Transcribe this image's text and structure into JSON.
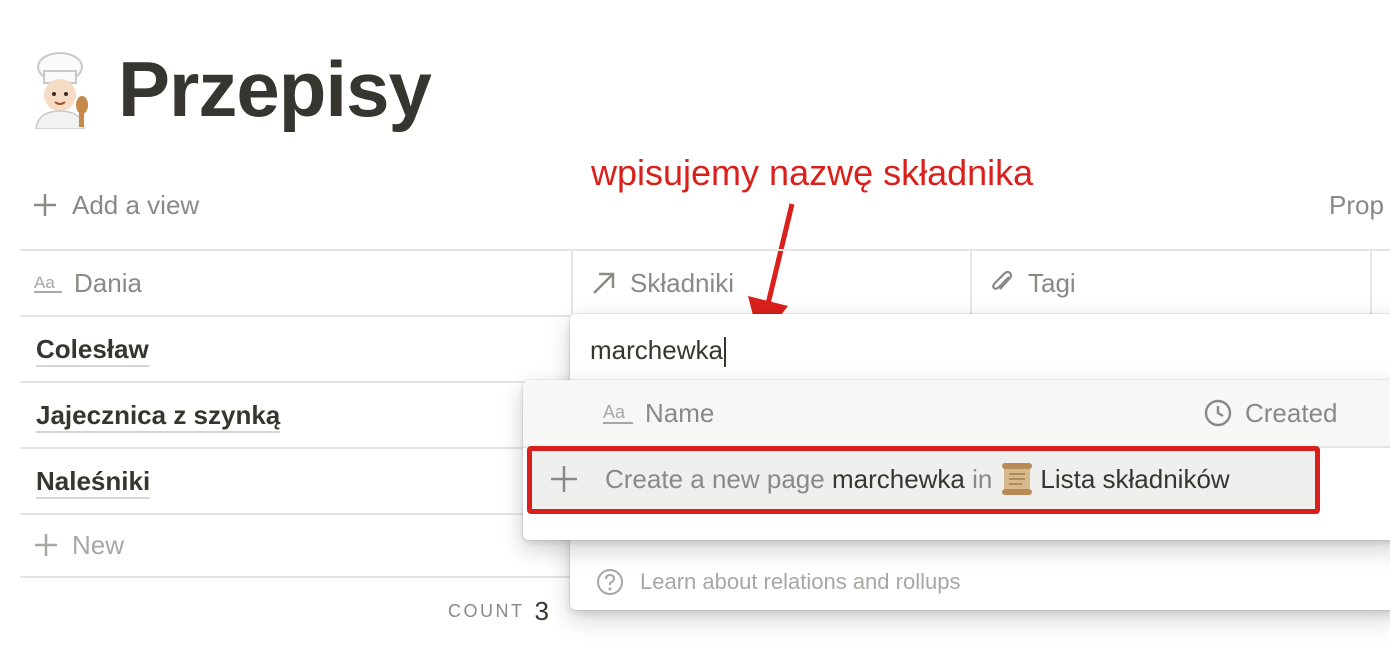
{
  "page": {
    "title": "Przepisy",
    "icon": "chef-emoji-icon"
  },
  "annotation": {
    "text": "wpisujemy nazwę składnika",
    "color": "#d9201c"
  },
  "toolbar": {
    "add_view_label": "Add a view",
    "properties_label": "Prop"
  },
  "table": {
    "columns": [
      {
        "label": "Dania",
        "icon": "text-aa-icon"
      },
      {
        "label": "Składniki",
        "icon": "relation-arrow-icon"
      },
      {
        "label": "Tagi",
        "icon": "paperclip-icon"
      }
    ],
    "rows": [
      "Colesław",
      "Jajecznica z szynką",
      "Naleśniki"
    ],
    "new_label": "New",
    "count_label": "COUNT",
    "count_value": "3"
  },
  "relation_popup": {
    "search_value": "marchewka",
    "footer": "Learn about relations and rollups"
  },
  "dropdown": {
    "columns": [
      {
        "label": "Name",
        "icon": "text-aa-icon"
      },
      {
        "label": "Created",
        "icon": "clock-icon"
      }
    ],
    "create": {
      "prefix": "Create a new page",
      "value": "marchewka",
      "in_word": "in",
      "database": "Lista składników",
      "database_icon": "scroll-icon"
    }
  },
  "colors": {
    "text": "#37352f",
    "muted": "#8a8986",
    "highlight": "#d9201c"
  }
}
